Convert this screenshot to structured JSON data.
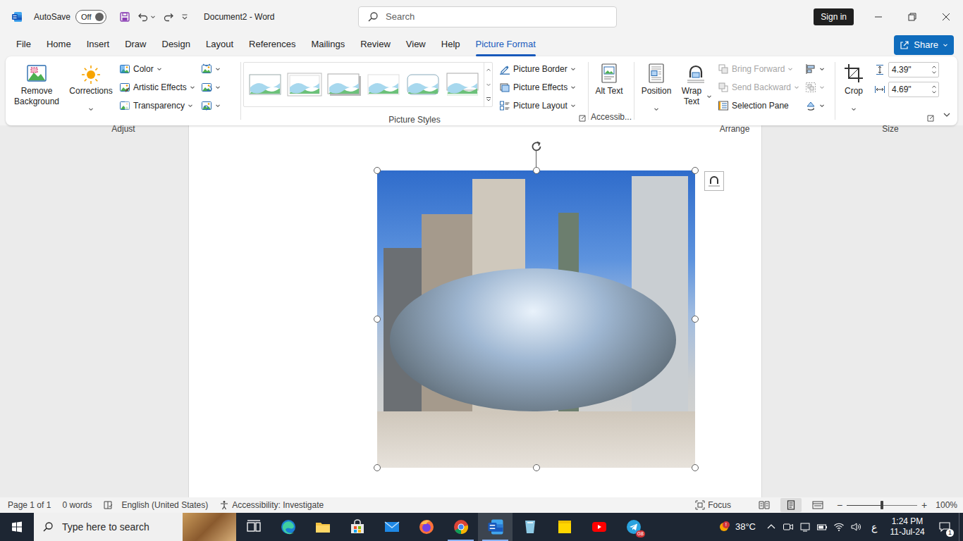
{
  "window": {
    "title": "Document2 - Word",
    "autosave": {
      "label": "AutoSave",
      "state": "Off",
      "on": false
    }
  },
  "search": {
    "placeholder": "Search"
  },
  "account": {
    "sign_in": "Sign in"
  },
  "menu_tabs": [
    {
      "label": "File",
      "selected": false
    },
    {
      "label": "Home",
      "selected": false
    },
    {
      "label": "Insert",
      "selected": false
    },
    {
      "label": "Draw",
      "selected": false
    },
    {
      "label": "Design",
      "selected": false
    },
    {
      "label": "Layout",
      "selected": false
    },
    {
      "label": "References",
      "selected": false
    },
    {
      "label": "Mailings",
      "selected": false
    },
    {
      "label": "Review",
      "selected": false
    },
    {
      "label": "View",
      "selected": false
    },
    {
      "label": "Help",
      "selected": false
    },
    {
      "label": "Picture Format",
      "selected": true
    }
  ],
  "share": {
    "label": "Share"
  },
  "ribbon": {
    "adjust": {
      "title": "Adjust",
      "remove_background": "Remove Background",
      "corrections": "Corrections",
      "menus": [
        {
          "label": "Color",
          "kind": "color"
        },
        {
          "label": "Artistic Effects",
          "kind": "artistic"
        },
        {
          "label": "Transparency",
          "kind": "transparency"
        }
      ],
      "tools": [
        {
          "kind": "compress"
        },
        {
          "kind": "change"
        },
        {
          "kind": "reset"
        }
      ]
    },
    "picture_styles": {
      "title": "Picture Styles",
      "gallery": [
        {
          "kind": "simple"
        },
        {
          "kind": "frame"
        },
        {
          "kind": "shadow"
        },
        {
          "kind": "soft"
        },
        {
          "kind": "rounded"
        },
        {
          "kind": "reflected"
        }
      ],
      "commands": [
        {
          "label": "Picture Border",
          "kind": "border"
        },
        {
          "label": "Picture Effects",
          "kind": "effects"
        },
        {
          "label": "Picture Layout",
          "kind": "layout"
        }
      ]
    },
    "accessibility": {
      "title": "Accessib...",
      "alt_text": "Alt Text"
    },
    "arrange": {
      "title": "Arrange",
      "position": "Position",
      "wrap_text": "Wrap Text",
      "commands": [
        {
          "label": "Bring Forward",
          "kind": "forward",
          "disabled": true
        },
        {
          "label": "Send Backward",
          "kind": "backward",
          "disabled": true
        },
        {
          "label": "Selection Pane",
          "kind": "pane",
          "disabled": false
        }
      ],
      "tools": [
        {
          "kind": "align",
          "disabled": false
        },
        {
          "kind": "group",
          "disabled": true
        },
        {
          "kind": "rotate",
          "disabled": false
        }
      ]
    },
    "size": {
      "title": "Size",
      "crop": "Crop",
      "height": "4.39\"",
      "width": "4.69\""
    }
  },
  "picture": {
    "selected": true
  },
  "status_bar": {
    "page": "Page 1 of 1",
    "words": "0 words",
    "language": "English (United States)",
    "accessibility": "Accessibility: Investigate",
    "focus": "Focus",
    "views": [
      {
        "kind": "read",
        "selected": false
      },
      {
        "kind": "print",
        "selected": true
      },
      {
        "kind": "web",
        "selected": false
      }
    ],
    "zoom_out": "−",
    "zoom_in": "+",
    "zoom": "100%",
    "zoom_level": 0.5
  },
  "taskbar": {
    "search_placeholder": "Type here to search",
    "apps": [
      {
        "kind": "task-view",
        "running": false,
        "active": false
      },
      {
        "kind": "edge",
        "running": false,
        "active": false
      },
      {
        "kind": "explorer",
        "running": false,
        "active": false
      },
      {
        "kind": "store",
        "running": false,
        "active": false
      },
      {
        "kind": "mail",
        "running": false,
        "active": false
      },
      {
        "kind": "firefox",
        "running": false,
        "active": false
      },
      {
        "kind": "chrome",
        "running": true,
        "active": false
      },
      {
        "kind": "word",
        "running": true,
        "active": true
      },
      {
        "kind": "app",
        "running": false,
        "active": false
      },
      {
        "kind": "sticky-notes",
        "running": false,
        "active": false
      },
      {
        "kind": "youtube",
        "running": false,
        "active": false
      },
      {
        "kind": "telegram",
        "running": false,
        "active": false,
        "badge": "08"
      }
    ],
    "weather": {
      "temperature": "38°C",
      "alert": "!"
    },
    "language": "ع",
    "time": "1:24 PM",
    "date": "11-Jul-24",
    "notifications": "1"
  }
}
